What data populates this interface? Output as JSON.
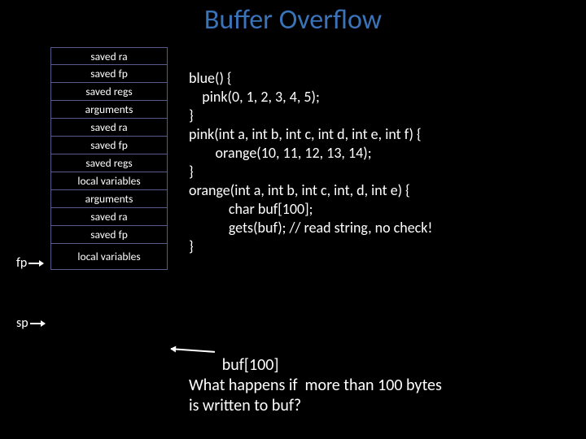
{
  "title": "Buffer Overflow",
  "stack": {
    "cells": [
      "saved ra",
      "saved fp",
      "saved regs",
      "arguments",
      "saved ra",
      "saved fp",
      "saved regs",
      "local variables",
      "arguments",
      "saved ra",
      "saved fp",
      "local variables"
    ]
  },
  "pointers": {
    "fp": "fp",
    "sp": "sp"
  },
  "code": {
    "l1": "blue() {",
    "l2": "    pink(0, 1, 2, 3, 4, 5);",
    "l3": "}",
    "l4": "pink(int a, int b, int c, int d, int e, int f) {",
    "l5": "        orange(10, 11, 12, 13, 14);",
    "l6": "}",
    "l7": "orange(int a, int b, int c, int, d, int e) {",
    "l8": "            char buf[100];",
    "l9": "            gets(buf); // read string, no check!",
    "l10": "}"
  },
  "question": {
    "l1": "         buf[100]",
    "l2": "What happens if  more than 100 bytes",
    "l3": "is written to buf?"
  }
}
